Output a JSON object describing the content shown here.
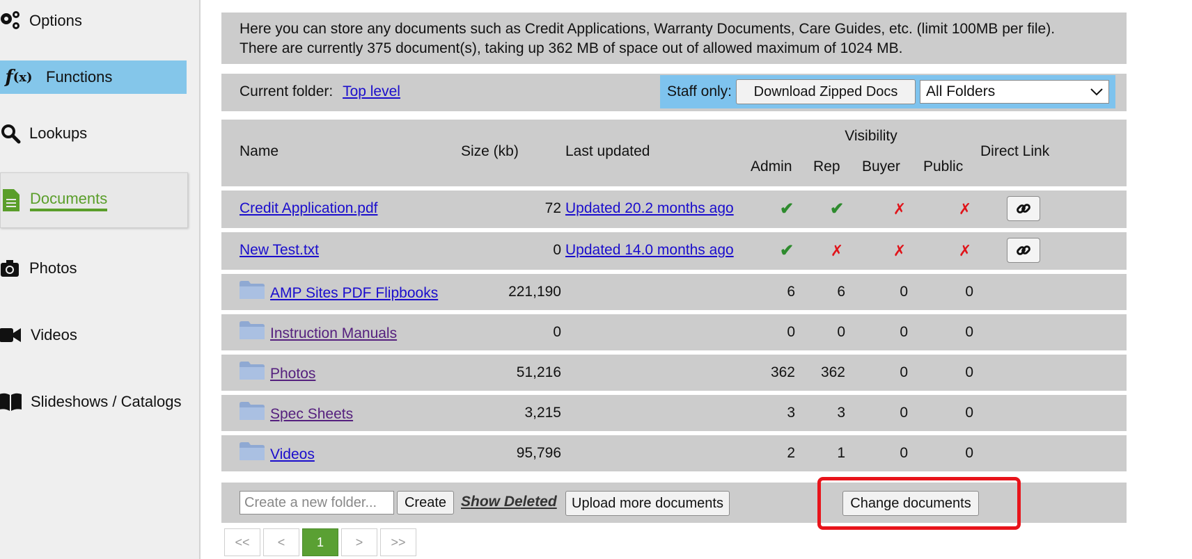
{
  "sidebar": {
    "items": [
      {
        "label": "Options",
        "icon": "gears-icon"
      },
      {
        "label": "Functions",
        "icon": "function-icon"
      },
      {
        "label": "Lookups",
        "icon": "search-icon"
      },
      {
        "label": "Documents",
        "icon": "document-icon"
      },
      {
        "label": "Photos",
        "icon": "camera-icon"
      },
      {
        "label": "Videos",
        "icon": "video-camera-icon"
      },
      {
        "label": "Slideshows / Catalogs",
        "icon": "book-icon"
      }
    ]
  },
  "info": {
    "line1": "Here you can store any documents such as Credit Applications, Warranty Documents, Care Guides, etc. (limit 100MB per file).",
    "line2": "There are currently 375 document(s), taking up 362 MB of space out of allowed maximum of 1024 MB."
  },
  "folderbar": {
    "current_label": "Current folder:",
    "current_link": "Top level",
    "staff_label": "Staff only:",
    "download_button": "Download Zipped Docs",
    "folder_select": "All Folders"
  },
  "table": {
    "headers": {
      "name": "Name",
      "size": "Size (kb)",
      "updated": "Last updated",
      "visibility": "Visibility",
      "admin": "Admin",
      "rep": "Rep",
      "buyer": "Buyer",
      "public": "Public",
      "direct_link": "Direct Link"
    },
    "files": [
      {
        "name": "Credit Application.pdf",
        "size": "72",
        "updated": "Updated 20.2 months ago",
        "admin": "✔",
        "rep": "✔",
        "buyer": "✗",
        "public": "✗"
      },
      {
        "name": "New Test.txt",
        "size": "0",
        "updated": "Updated 14.0 months ago",
        "admin": "✔",
        "rep": "✗",
        "buyer": "✗",
        "public": "✗"
      }
    ],
    "folders": [
      {
        "name": "AMP Sites PDF Flipbooks",
        "size": "221,190",
        "admin": "6",
        "rep": "6",
        "buyer": "0",
        "public": "0"
      },
      {
        "name": "Instruction Manuals",
        "size": "0",
        "admin": "0",
        "rep": "0",
        "buyer": "0",
        "public": "0"
      },
      {
        "name": "Photos",
        "size": "51,216",
        "admin": "362",
        "rep": "362",
        "buyer": "0",
        "public": "0"
      },
      {
        "name": "Spec Sheets",
        "size": "3,215",
        "admin": "3",
        "rep": "3",
        "buyer": "0",
        "public": "0"
      },
      {
        "name": "Videos",
        "size": "95,796",
        "admin": "2",
        "rep": "1",
        "buyer": "0",
        "public": "0"
      }
    ]
  },
  "footer": {
    "new_folder_placeholder": "Create a new folder...",
    "create_button": "Create",
    "show_deleted": "Show Deleted",
    "upload_button": "Upload more documents",
    "change_button": "Change documents"
  },
  "pager": {
    "first": "<<",
    "prev": "<",
    "current": "1",
    "next": ">",
    "last": ">>"
  },
  "colors": {
    "accent_blue": "#84c6ea",
    "active_green": "#5a9e2a",
    "highlight_red": "#e8141b",
    "row_gray": "#cccccc"
  }
}
